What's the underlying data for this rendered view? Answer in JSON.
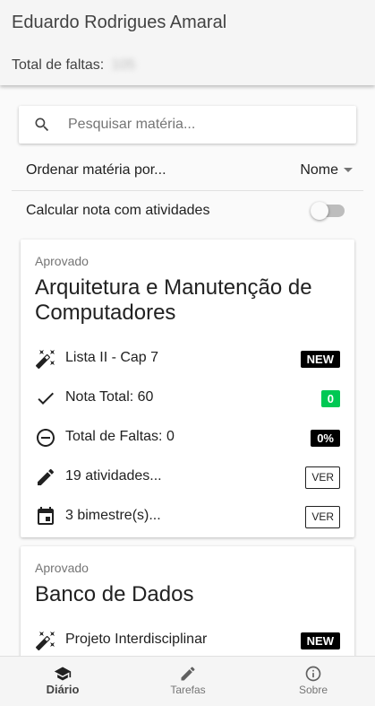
{
  "header": {
    "student_name": "Eduardo Rodrigues Amaral",
    "total_faltas_label": "Total de faltas:",
    "total_faltas_value": "105"
  },
  "search": {
    "placeholder": "Pesquisar matéria...",
    "value": "",
    "icon": "search-icon"
  },
  "sort": {
    "label": "Ordenar matéria por...",
    "selected": "Nome"
  },
  "calc": {
    "label": "Calcular nota com atividades",
    "enabled": false
  },
  "cards": [
    {
      "status": "Aprovado",
      "title": "Arquitetura e Manutenção de Computadores",
      "rows": [
        {
          "icon": "magic-wand-icon",
          "text": "Lista II - Cap 7",
          "badge": "NEW"
        },
        {
          "icon": "check-icon",
          "text": "Nota Total: 60",
          "badge": "0",
          "badge_color": "#00c853"
        },
        {
          "icon": "minus-circle-icon",
          "text": "Total de Faltas: 0",
          "badge": "0%"
        },
        {
          "icon": "pencil-icon",
          "text": "19 atividades...",
          "button": "VER"
        },
        {
          "icon": "calendar-icon",
          "text": "3 bimestre(s)...",
          "button": "VER"
        }
      ]
    },
    {
      "status": "Aprovado",
      "title": "Banco de Dados",
      "rows": [
        {
          "icon": "magic-wand-icon",
          "text": "Projeto Interdisciplinar",
          "badge": "NEW"
        }
      ]
    }
  ],
  "bottom_nav": [
    {
      "icon": "school-icon",
      "label": "Diário",
      "active": true
    },
    {
      "icon": "pencil-icon",
      "label": "Tarefas",
      "active": false
    },
    {
      "icon": "info-icon",
      "label": "Sobre",
      "active": false
    }
  ],
  "colors": {
    "header_bg": "#f5f5f5",
    "badge_dark": "#000000",
    "badge_green": "#00c853",
    "text_primary": "#212121",
    "text_secondary": "#757575"
  }
}
